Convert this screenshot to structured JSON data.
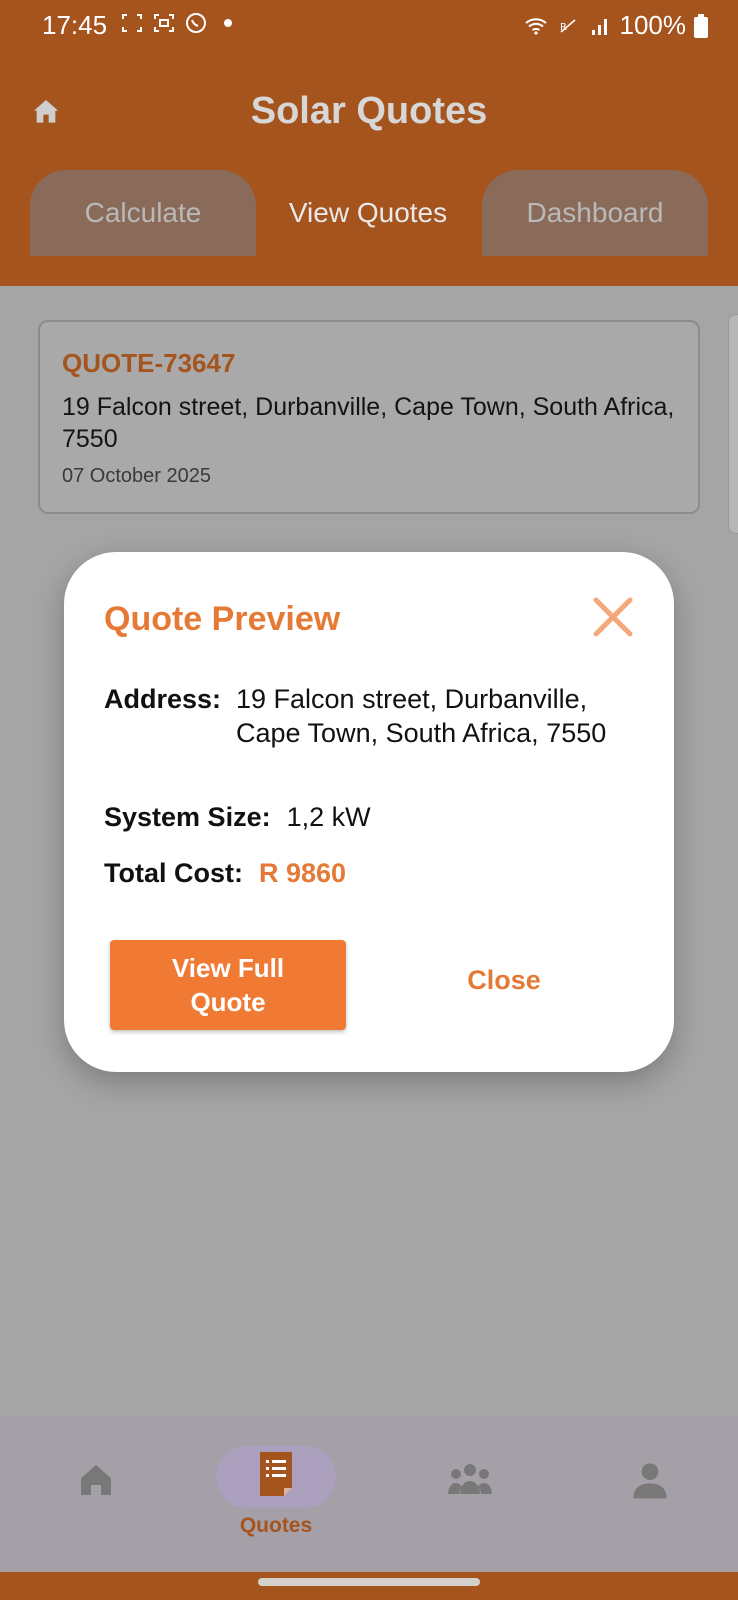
{
  "status_bar": {
    "time": "17:45",
    "battery": "100%"
  },
  "app_bar": {
    "title": "Solar Quotes"
  },
  "tabs": [
    {
      "label": "Calculate"
    },
    {
      "label": "View Quotes"
    },
    {
      "label": "Dashboard"
    }
  ],
  "quote_card": {
    "id": "QUOTE-73647",
    "address": "19 Falcon street, Durbanville, Cape Town, South Africa, 7550",
    "date": "07 October 2025"
  },
  "modal": {
    "title": "Quote Preview",
    "address_label": "Address:",
    "address_value": "19 Falcon street, Durbanville, Cape Town, South Africa, 7550",
    "system_size_label": "System Size:",
    "system_size_value": "1,2 kW",
    "total_cost_label": "Total Cost:",
    "total_cost_value": "R 9860",
    "view_full_label_line1": "View Full",
    "view_full_label_line2": "Quote",
    "close_label": "Close"
  },
  "bottom_nav": {
    "items": [
      {
        "icon": "home-icon",
        "label": ""
      },
      {
        "icon": "quotes-icon",
        "label": "Quotes"
      },
      {
        "icon": "group-icon",
        "label": ""
      },
      {
        "icon": "person-icon",
        "label": ""
      }
    ],
    "active_index": 1
  },
  "colors": {
    "brand_dark": "#a5541e",
    "accent": "#f07a33"
  }
}
